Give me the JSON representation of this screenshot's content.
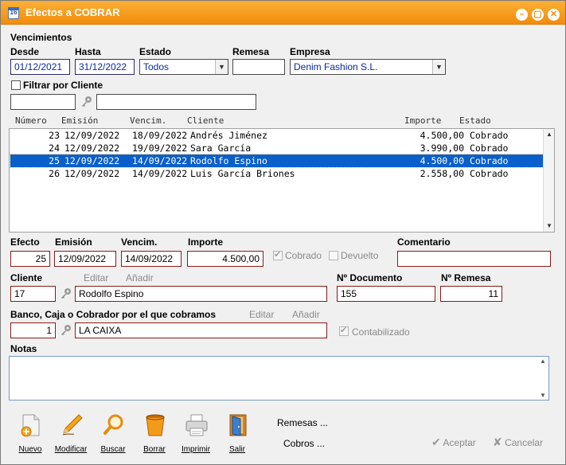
{
  "window": {
    "title": "Efectos a COBRAR",
    "calendar_number": "16"
  },
  "filters": {
    "section_label": "Vencimientos",
    "desde_label": "Desde",
    "desde_value": "01/12/2021",
    "hasta_label": "Hasta",
    "hasta_value": "31/12/2022",
    "estado_label": "Estado",
    "estado_value": "Todos",
    "remesa_label": "Remesa",
    "remesa_value": "",
    "empresa_label": "Empresa",
    "empresa_value": "Denim Fashion S.L.",
    "filtrar_label": "Filtrar por Cliente",
    "cliente_code": "",
    "cliente_name": ""
  },
  "grid": {
    "columns": [
      "Número",
      "Emisión",
      "Vencim.",
      "Cliente",
      "Importe",
      "Estado"
    ],
    "rows": [
      {
        "numero": "23",
        "emision": "12/09/2022",
        "vencim": "18/09/2022",
        "cliente": "Andrés Jiménez",
        "importe": "4.500,00",
        "estado": "Cobrado"
      },
      {
        "numero": "24",
        "emision": "12/09/2022",
        "vencim": "19/09/2022",
        "cliente": "Sara García",
        "importe": "3.990,00",
        "estado": "Cobrado"
      },
      {
        "numero": "25",
        "emision": "12/09/2022",
        "vencim": "14/09/2022",
        "cliente": "Rodolfo Espino",
        "importe": "4.500,00",
        "estado": "Cobrado"
      },
      {
        "numero": "26",
        "emision": "12/09/2022",
        "vencim": "14/09/2022",
        "cliente": "Luis García Briones",
        "importe": "2.558,00",
        "estado": "Cobrado"
      }
    ],
    "selected_index": 2
  },
  "detail": {
    "efecto_label": "Efecto",
    "efecto_value": "25",
    "emision_label": "Emisión",
    "emision_value": "12/09/2022",
    "vencim_label": "Vencim.",
    "vencim_value": "14/09/2022",
    "importe_label": "Importe",
    "importe_value": "4.500,00",
    "cobrado_label": "Cobrado",
    "devuelto_label": "Devuelto",
    "comentario_label": "Comentario",
    "comentario_value": "",
    "cliente_label": "Cliente",
    "cliente_code": "17",
    "cliente_name": "Rodolfo Espino",
    "editar_label": "Editar",
    "anadir_label": "Añadir",
    "ndoc_label": "Nº Documento",
    "ndoc_value": "155",
    "nremesa_label": "Nº Remesa",
    "nremesa_value": "11",
    "banco_label": "Banco, Caja o Cobrador por el que cobramos",
    "banco_code": "1",
    "banco_name": "LA CAIXA",
    "contabilizado_label": "Contabilizado",
    "notas_label": "Notas",
    "notas_value": ""
  },
  "toolbar": {
    "nuevo": "Nuevo",
    "modificar": "Modificar",
    "buscar": "Buscar",
    "borrar": "Borrar",
    "imprimir": "Imprimir",
    "salir": "Salir",
    "remesas": "Remesas ...",
    "cobros": "Cobros ...",
    "aceptar": "Aceptar",
    "cancelar": "Cancelar"
  },
  "colors": {
    "title_orange": "#f28c0c",
    "selection_blue": "#0a5fcb",
    "field_text_blue": "#0b2a9e",
    "field_border_red": "#8a1a1a"
  }
}
